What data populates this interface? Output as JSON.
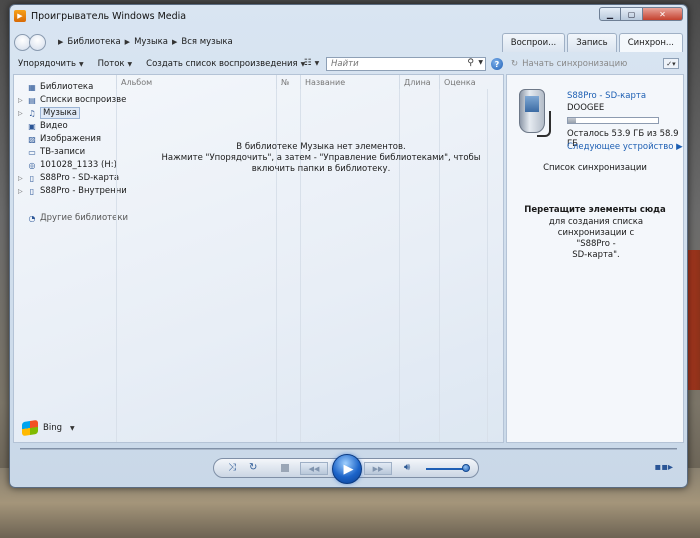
{
  "window": {
    "title": "Проигрыватель Windows Media"
  },
  "breadcrumb": [
    "Библиотека",
    "Музыка",
    "Вся музыка"
  ],
  "tabs": [
    {
      "label": "Воспрои...",
      "active": false
    },
    {
      "label": "Запись",
      "active": false
    },
    {
      "label": "Синхрон...",
      "active": true
    }
  ],
  "toolbar": {
    "organize": "Упорядочить",
    "stream": "Поток",
    "create_playlist": "Создать список воспроизведения",
    "search_placeholder": "Найти"
  },
  "sync_toolbar": {
    "start_sync": "Начать синхронизацию"
  },
  "nav": {
    "items": [
      {
        "label": "Библиотека",
        "icon": "library-icon"
      },
      {
        "label": "Списки воспроизве",
        "icon": "playlist-icon"
      },
      {
        "label": "Музыка",
        "icon": "music-note-icon"
      },
      {
        "label": "Видео",
        "icon": "video-icon"
      },
      {
        "label": "Изображения",
        "icon": "pictures-icon"
      },
      {
        "label": "ТВ-записи",
        "icon": "tv-icon"
      },
      {
        "label": "101028_1133 (H:)",
        "icon": "disc-icon"
      },
      {
        "label": "S88Pro - SD-карта",
        "icon": "device-icon"
      },
      {
        "label": "S88Pro - Внутренни",
        "icon": "device-icon"
      },
      {
        "label": "Другие библиотеки",
        "icon": "other-libraries-icon"
      }
    ],
    "bing": "Bing"
  },
  "columns": [
    "Альбом",
    "№",
    "Название",
    "Длина",
    "Оценка"
  ],
  "empty_message": {
    "line1": "В библиотеке Музыка нет элементов.",
    "line2": "Нажмите \"Упорядочить\", а затем - \"Управление библиотеками\", чтобы",
    "line3": "включить папки в библиотеку."
  },
  "device": {
    "name": "S88Pro - SD-карта",
    "model": "DOOGEE",
    "capacity_text": "Осталось 53.9 ГБ из 58.9 ГБ",
    "capacity_used_fraction": 0.085,
    "next_device": "Следующее устройство"
  },
  "sync_list": {
    "title": "Список синхронизации",
    "drag_title": "Перетащите элементы сюда",
    "drag_desc_1": "для создания списка",
    "drag_desc_2": "синхронизации с \"S88Pro -",
    "drag_desc_3": "SD-карта\"."
  },
  "player": {
    "volume_fraction": 1.0
  }
}
